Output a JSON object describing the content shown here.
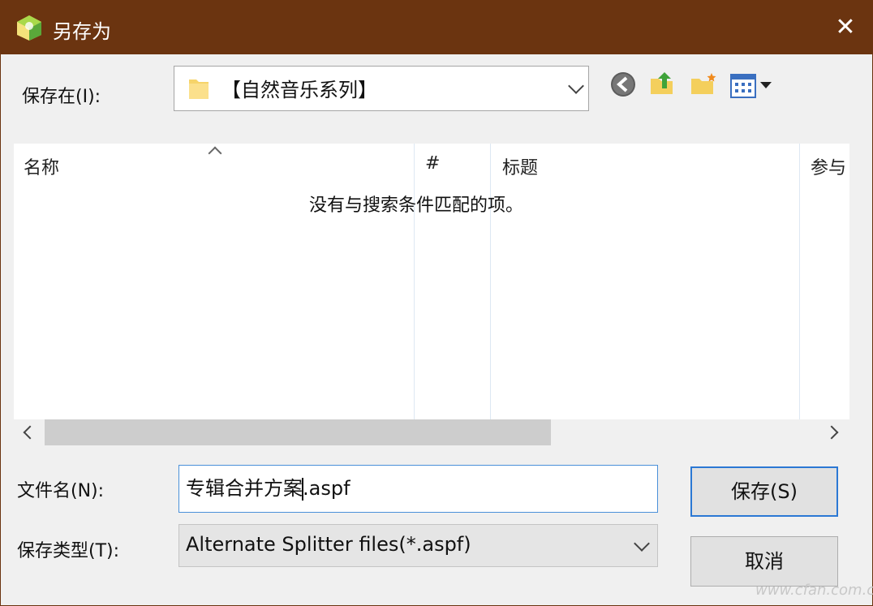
{
  "window": {
    "title": "另存为",
    "close_glyph": "✕"
  },
  "location": {
    "label": "保存在(I):",
    "value": "【自然音乐系列】"
  },
  "toolbar": {
    "icons": [
      "back-icon",
      "up-folder-icon",
      "new-folder-icon",
      "view-menu-icon"
    ]
  },
  "file_list": {
    "columns": [
      "名称",
      "#",
      "标题",
      "参与"
    ],
    "empty_message": "没有与搜索条件匹配的项。"
  },
  "filename": {
    "label": "文件名(N):",
    "value_before_caret": "专辑合并方案",
    "value_after_caret": ".aspf"
  },
  "filetype": {
    "label": "保存类型(T):",
    "value": "Alternate Splitter files(*.aspf)"
  },
  "buttons": {
    "save": "保存(S)",
    "cancel": "取消"
  },
  "watermark": "www.cfan.com.cn",
  "colors": {
    "titlebar": "#6b3410",
    "focus": "#2b78d4"
  }
}
